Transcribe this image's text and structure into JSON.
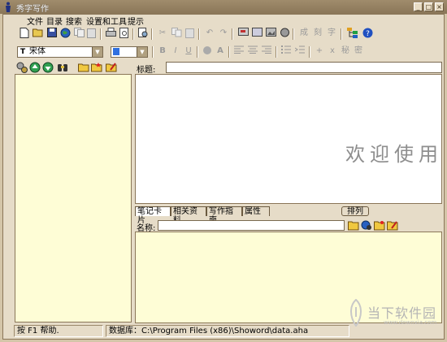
{
  "window": {
    "title": "秀字写作"
  },
  "menu": [
    "文件",
    "目录",
    "搜索",
    "设置和工具",
    "提示"
  ],
  "toolbar2": {
    "font_name": "宋体",
    "bold": "B",
    "italic": "I",
    "underline": "U",
    "font_color": "A",
    "text_tools": [
      "成",
      "刻",
      "字",
      "+",
      "x",
      "秘",
      "密"
    ]
  },
  "editor": {
    "title_label": "标题:",
    "title_value": "",
    "welcome_text": "欢迎使用"
  },
  "tabs": [
    "笔记卡片",
    "相关资料",
    "写作指南",
    "属性"
  ],
  "arrange_button": "排列",
  "name_field": {
    "label": "名称:",
    "value": ""
  },
  "status": {
    "help": "按 F1 帮助.",
    "database": "数据库：C:\\Program Files (x86)\\Showord\\data.aha"
  },
  "watermark": {
    "brand": "当下软件园",
    "url": "www.downxia.com"
  },
  "colors": {
    "chrome": "#e6dcc8",
    "pane": "#fefdd6",
    "editor": "#ffffff",
    "accent": "#8a7658"
  }
}
